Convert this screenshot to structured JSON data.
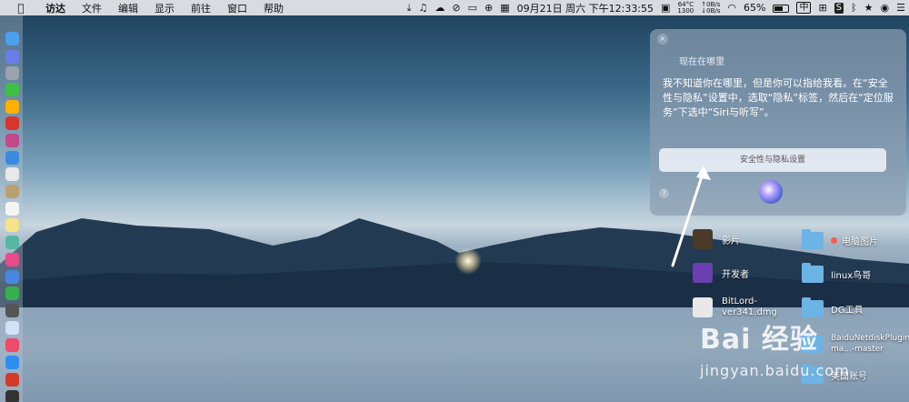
{
  "menubar": {
    "apple": "",
    "items": [
      "访达",
      "文件",
      "编辑",
      "显示",
      "前往",
      "窗口",
      "帮助"
    ],
    "status": {
      "datetime": "09月21日 周六 下午12:33:55",
      "temp": "64°C",
      "rpm": "1300",
      "net_up": "↑0B/s",
      "net_down": "↓0B/s",
      "battery": "65%",
      "input_method": "中",
      "s_icon": "S"
    }
  },
  "siri": {
    "heard": "现在在哪里",
    "reply": "我不知道你在哪里，但是你可以指给我看。在“安全性与隐私”设置中，选取“隐私”标签，然后在“定位服务”下选中“Siri与听写”。",
    "button": "安全性与隐私设置",
    "close": "×",
    "help": "?"
  },
  "desktop": {
    "items": [
      {
        "label": "影片"
      },
      {
        "label": "开发者"
      },
      {
        "label": "BitLord-ver341.dmg"
      },
      {
        "label": "电脑图片"
      },
      {
        "label": "linux鸟哥"
      },
      {
        "label": "DG工具"
      },
      {
        "label": "BaiduNetdiskPlugin-ma...-master"
      },
      {
        "label": "美国账号"
      }
    ]
  },
  "watermark": {
    "brand": "Bai  经验",
    "url": "jingyan.baidu.com"
  },
  "colors": {
    "accent_folder": "#6cb3e6",
    "tag_red": "#ff5a4e"
  }
}
